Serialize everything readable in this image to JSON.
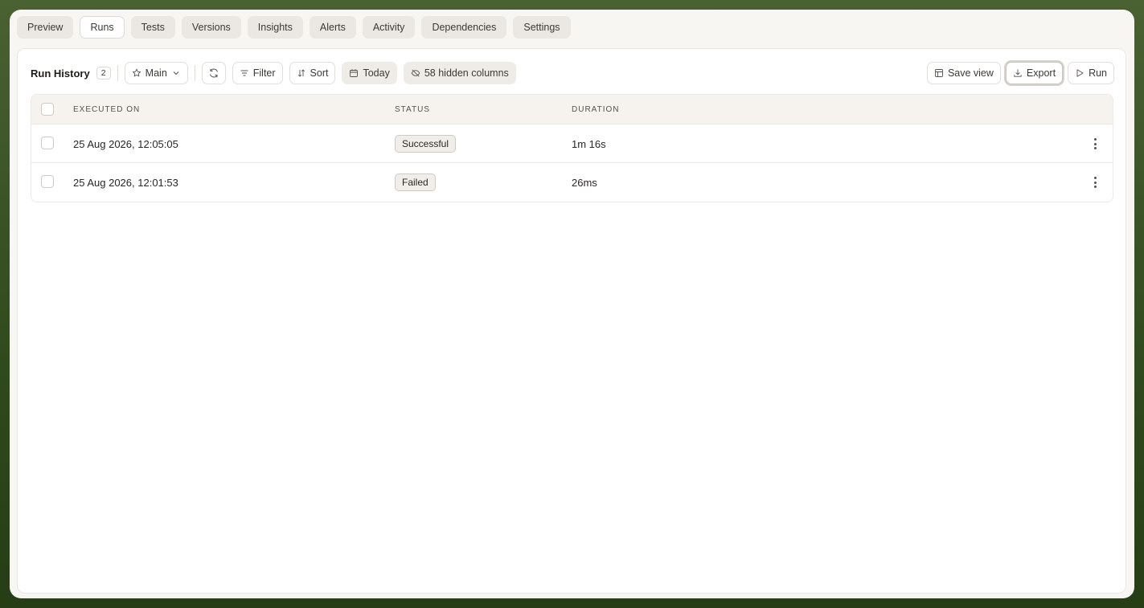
{
  "tabs": [
    {
      "label": "Preview",
      "active": false
    },
    {
      "label": "Runs",
      "active": true
    },
    {
      "label": "Tests",
      "active": false
    },
    {
      "label": "Versions",
      "active": false
    },
    {
      "label": "Insights",
      "active": false
    },
    {
      "label": "Alerts",
      "active": false
    },
    {
      "label": "Activity",
      "active": false
    },
    {
      "label": "Dependencies",
      "active": false
    },
    {
      "label": "Settings",
      "active": false
    }
  ],
  "toolbar": {
    "title": "Run History",
    "count": "2",
    "view_label": "Main",
    "filter_label": "Filter",
    "sort_label": "Sort",
    "date_label": "Today",
    "hidden_columns_label": "58 hidden columns",
    "save_view_label": "Save view",
    "export_label": "Export",
    "run_label": "Run"
  },
  "table": {
    "columns": [
      "EXECUTED ON",
      "STATUS",
      "DURATION"
    ],
    "rows": [
      {
        "executed_on": "25 Aug 2026, 12:05:05",
        "status": "Successful",
        "duration": "1m 16s"
      },
      {
        "executed_on": "25 Aug 2026, 12:01:53",
        "status": "Failed",
        "duration": "26ms"
      }
    ]
  },
  "icons": {
    "view": "star-icon",
    "refresh": "refresh-icon",
    "filter": "filter-icon",
    "sort": "sort-icon",
    "date": "calendar-icon",
    "hidden": "eye-off-icon",
    "save_view": "layout-icon",
    "export": "download-icon",
    "run": "play-icon",
    "row_menu": "more-vertical-icon"
  },
  "colors": {
    "background": "#3b5426",
    "window": "#f8f6f3",
    "panel": "#ffffff",
    "badge_bg": "#f1eeea"
  }
}
